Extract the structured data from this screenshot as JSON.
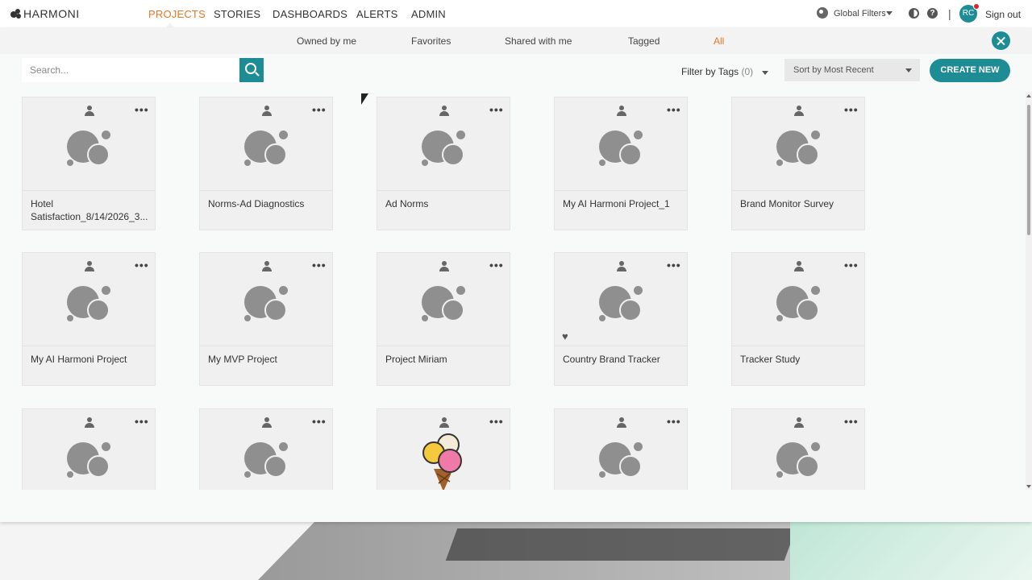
{
  "brand": {
    "name": "HARMONI"
  },
  "nav": {
    "items": [
      {
        "label": "PROJECTS",
        "active": true
      },
      {
        "label": "STORIES",
        "active": false
      },
      {
        "label": "DASHBOARDS",
        "active": false
      },
      {
        "label": "ALERTS",
        "active": false
      },
      {
        "label": "ADMIN",
        "active": false
      }
    ]
  },
  "header_right": {
    "global_filters": "Global Filters",
    "separator": "|",
    "help": "?",
    "avatar_initials": "RC",
    "sign_out": "Sign out"
  },
  "subnav": {
    "items": [
      {
        "label": "Owned by me",
        "active": false
      },
      {
        "label": "Favorites",
        "active": false
      },
      {
        "label": "Shared with me",
        "active": false
      },
      {
        "label": "Tagged",
        "active": false
      },
      {
        "label": "All",
        "active": true
      }
    ]
  },
  "toolbar": {
    "search_placeholder": "Search...",
    "filter_label": "Filter by Tags",
    "filter_count": "(0)",
    "sort_label": "Sort by Most Recent",
    "create_label": "CREATE NEW"
  },
  "projects": [
    {
      "title": "Hotel Satisfaction_8/14/2026_3...",
      "favorite": false
    },
    {
      "title": "Norms-Ad Diagnostics",
      "favorite": false
    },
    {
      "title": "Ad Norms",
      "favorite": false
    },
    {
      "title": "My AI Harmoni Project_1",
      "favorite": false
    },
    {
      "title": "Brand Monitor Survey",
      "favorite": false
    },
    {
      "title": "My AI Harmoni Project",
      "favorite": false
    },
    {
      "title": "My MVP Project",
      "favorite": false
    },
    {
      "title": "Project Miriam",
      "favorite": false
    },
    {
      "title": "Country Brand Tracker",
      "favorite": true
    },
    {
      "title": "Tracker Study",
      "favorite": false
    },
    {
      "title": "",
      "favorite": false
    },
    {
      "title": "",
      "favorite": false
    },
    {
      "title": "",
      "favorite": true,
      "thumbnail": "ice-cream"
    },
    {
      "title": "",
      "favorite": false
    },
    {
      "title": "",
      "favorite": false
    }
  ],
  "colors": {
    "accent": "#1e8c95",
    "active_nav": "#e87722",
    "notification": "#d9232d"
  },
  "icons": {
    "owner": "person-icon",
    "menu": "more-dots-icon",
    "favorite": "heart-icon",
    "placeholder": "bubbles-icon"
  }
}
